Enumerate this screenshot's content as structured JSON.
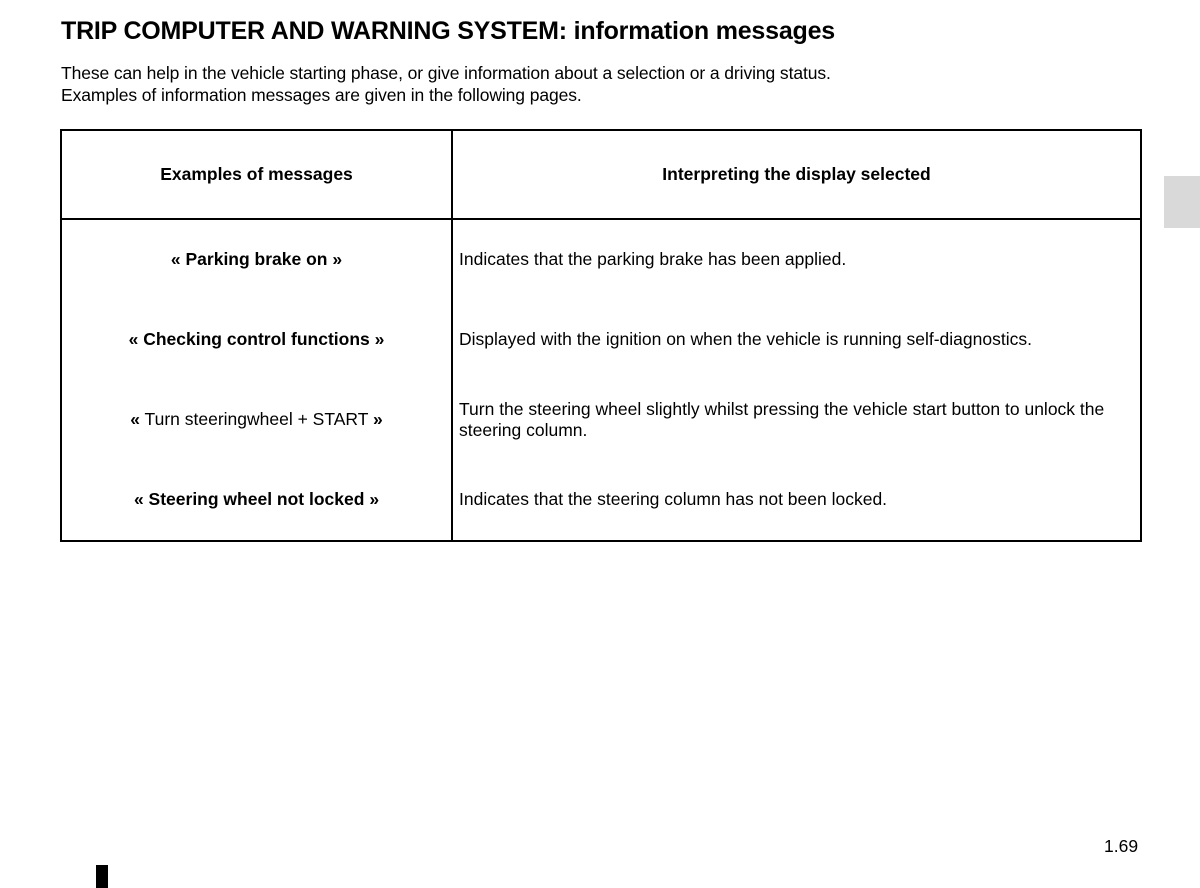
{
  "page": {
    "title": "TRIP COMPUTER AND WARNING SYSTEM: information messages",
    "intro": [
      "These can help in the vehicle starting phase, or give information about a selection or a driving status.",
      "Examples of information messages are given in the following pages."
    ],
    "page_number": "1.69",
    "side_tab_color": "#d9d9d9"
  },
  "table": {
    "headers": {
      "messages": "Examples of messages",
      "interpretation": "Interpreting the display selected"
    },
    "rows": [
      {
        "open_quote": "«",
        "message": "Parking brake on",
        "close_quote": "»",
        "message_bold": true,
        "interpretation": "Indicates that the parking brake has been applied."
      },
      {
        "open_quote": "«",
        "message": "Checking control functions",
        "close_quote": "»",
        "message_bold": true,
        "interpretation": "Displayed with the ignition on when the vehicle is running self-diagnostics."
      },
      {
        "open_quote": "«",
        "message": "Turn steeringwheel + START",
        "close_quote": "»",
        "message_bold": false,
        "interpretation": "Turn the steering wheel slightly whilst pressing the vehicle start button to unlock the steering column."
      },
      {
        "open_quote": "«",
        "message": "Steering wheel not locked",
        "close_quote": "»",
        "message_bold": true,
        "interpretation": "Indicates that the steering column has not been locked."
      }
    ]
  }
}
